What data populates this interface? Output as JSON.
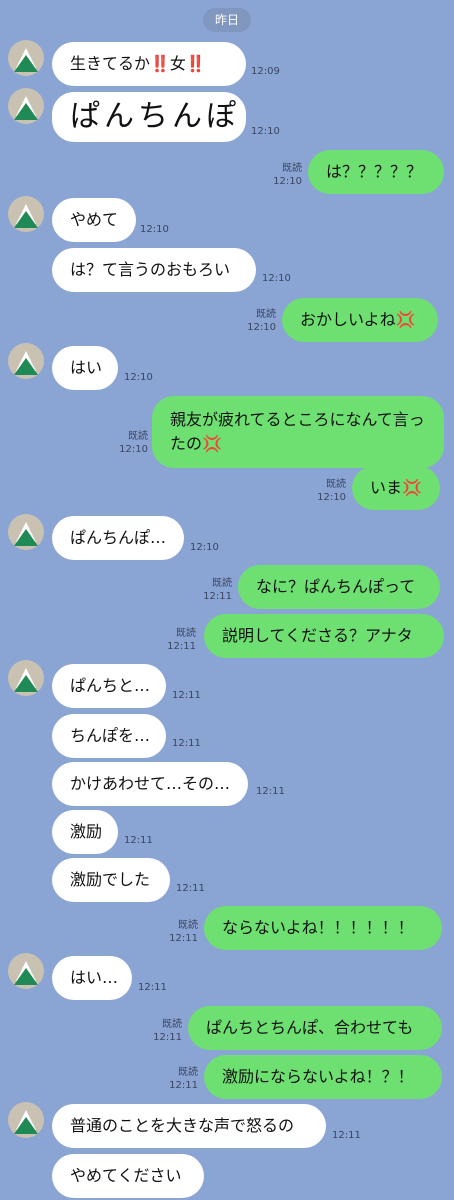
{
  "date_label": "昨日",
  "read_label": "既読",
  "messages": [
    {
      "side": "in",
      "text": "生きてるか‼️女‼️",
      "time": "12:09"
    },
    {
      "side": "in",
      "text": "ぱんちんぽ",
      "time": "12:10"
    },
    {
      "side": "out",
      "text": "は？？？？？",
      "time": "12:10"
    },
    {
      "side": "in",
      "text": "やめて",
      "time": "12:10"
    },
    {
      "side": "in",
      "text": "は？て言うのおもろい",
      "time": "12:10"
    },
    {
      "side": "out",
      "text": "おかしいよね💢",
      "time": "12:10"
    },
    {
      "side": "in",
      "text": "はい",
      "time": "12:10"
    },
    {
      "side": "out",
      "text": "親友が疲れてるところになんて言ったの💢",
      "time": "12:10"
    },
    {
      "side": "out",
      "text": "いま💢",
      "time": "12:10"
    },
    {
      "side": "in",
      "text": "ぱんちんぽ…",
      "time": "12:10"
    },
    {
      "side": "out",
      "text": "なに？ぱんちんぽって",
      "time": "12:11"
    },
    {
      "side": "out",
      "text": "説明してくださる？アナタ",
      "time": "12:11"
    },
    {
      "side": "in",
      "text": "ぱんちと…",
      "time": "12:11"
    },
    {
      "side": "in",
      "text": "ちんぽを…",
      "time": "12:11"
    },
    {
      "side": "in",
      "text": "かけあわせて…その…",
      "time": "12:11"
    },
    {
      "side": "in",
      "text": "激励",
      "time": "12:11"
    },
    {
      "side": "in",
      "text": "激励でした",
      "time": "12:11"
    },
    {
      "side": "out",
      "text": "ならないよね！！！！！！",
      "time": "12:11"
    },
    {
      "side": "in",
      "text": "はい…",
      "time": "12:11"
    },
    {
      "side": "out",
      "text": "ぱんちとちんぽ、合わせても",
      "time": "12:11"
    },
    {
      "side": "out",
      "text": "激励にならないよね！？！",
      "time": "12:11"
    },
    {
      "side": "in",
      "text": "普通のことを大きな声で怒るの",
      "time": "12:11"
    },
    {
      "side": "in",
      "text": "やめてください",
      "time": ""
    }
  ]
}
